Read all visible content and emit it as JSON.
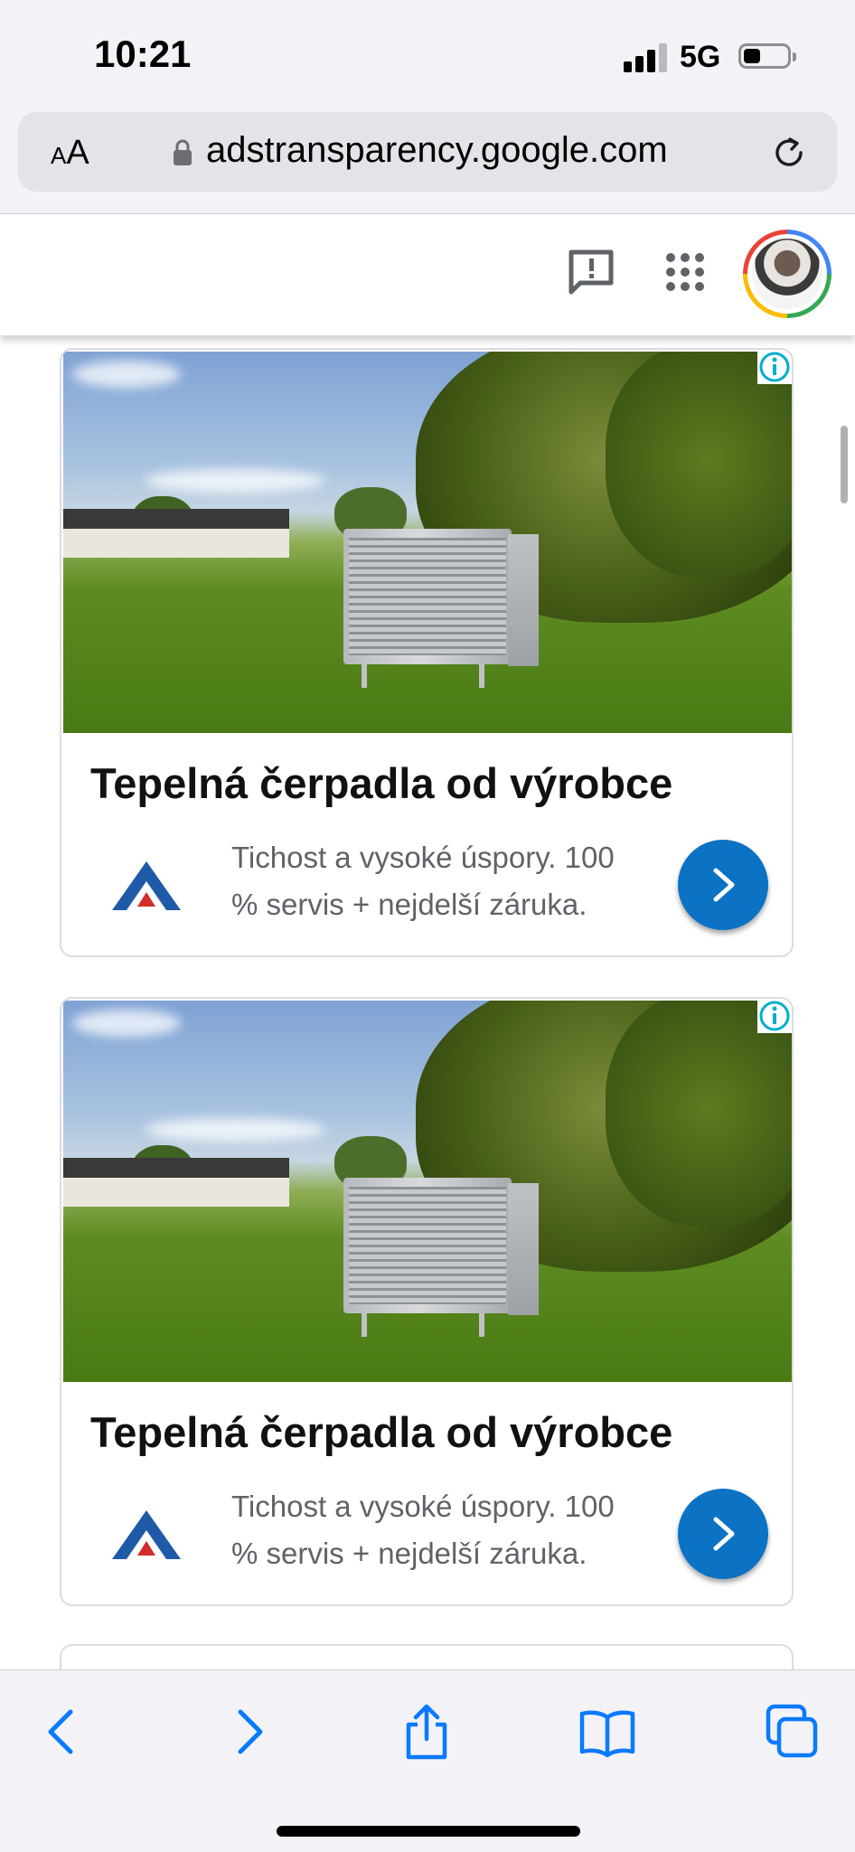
{
  "status_bar": {
    "time": "10:21",
    "network": "5G"
  },
  "browser": {
    "text_size_label_small": "A",
    "text_size_label_large": "A",
    "url": "adstransparency.google.com"
  },
  "header": {
    "icons": [
      "feedback-icon",
      "apps-grid-icon",
      "account-avatar"
    ],
    "avatar_ring_colors": [
      "#4285f4",
      "#34a853",
      "#fbbc05",
      "#ea4335"
    ]
  },
  "ads": [
    {
      "title": "Tepelná čerpadla od výrobce",
      "description_line1": "Tichost a vysoké úspory. 100",
      "description_line2": "% servis + nejdelší záruka.",
      "cta_color": "#0b72c4"
    },
    {
      "title": "Tepelná čerpadla od výrobce",
      "description_line1": "Tichost a vysoké úspory. 100",
      "description_line2": "% servis + nejdelší záruka.",
      "cta_color": "#0b72c4"
    }
  ],
  "toolbar": {
    "icons": [
      "back-icon",
      "forward-icon",
      "share-icon",
      "bookmarks-icon",
      "tabs-icon"
    ],
    "accent_color": "#0a7aff"
  }
}
